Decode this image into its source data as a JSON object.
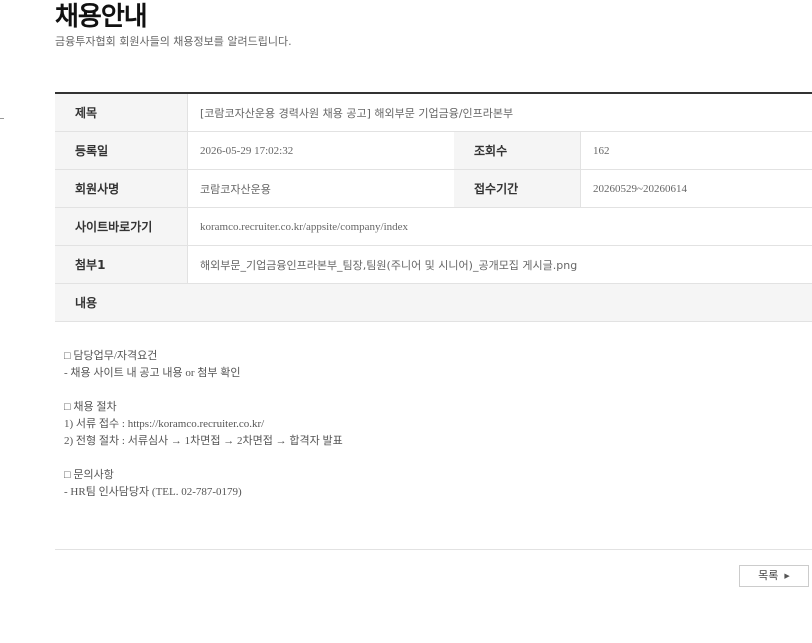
{
  "page": {
    "title": "채용안내",
    "subtitle": "금융투자협회 회원사들의 채용정보를 알려드립니다."
  },
  "post": {
    "title_label": "제목",
    "title_value": "[코람코자산운용 경력사원 채용 공고] 해외부문 기업금융/인프라본부",
    "date_label": "등록일",
    "date_value": "2026-05-29 17:02:32",
    "views_label": "조회수",
    "views_value": "162",
    "company_label": "회원사명",
    "company_value": "코람코자산운용",
    "period_label": "접수기간",
    "period_value": "20260529~20260614",
    "site_label": "사이트바로가기",
    "site_value": "koramco.recruiter.co.kr/appsite/company/index",
    "attach_label": "첨부1",
    "attach_value": "해외부문_기업금융인프라본부_팀장,팀원(주니어 및 시니어)_공개모집 게시글.png",
    "content_label": "내용"
  },
  "content": {
    "lines": [
      "□ 담당업무/자격요건",
      "- 채용 사이트 내 공고 내용 or 첨부 확인",
      "",
      "□ 채용 절차",
      "1) 서류 접수 : https://koramco.recruiter.co.kr/",
      "2) 전형 절차 : 서류심사 → 1차면접 → 2차면접 → 합격자 발표",
      "",
      "□ 문의사항",
      "- HR팀 인사담당자 (TEL. 02-787-0179)"
    ]
  },
  "buttons": {
    "list_label": "목록"
  },
  "icons": {
    "list_arrow": "triangle-right-icon"
  }
}
